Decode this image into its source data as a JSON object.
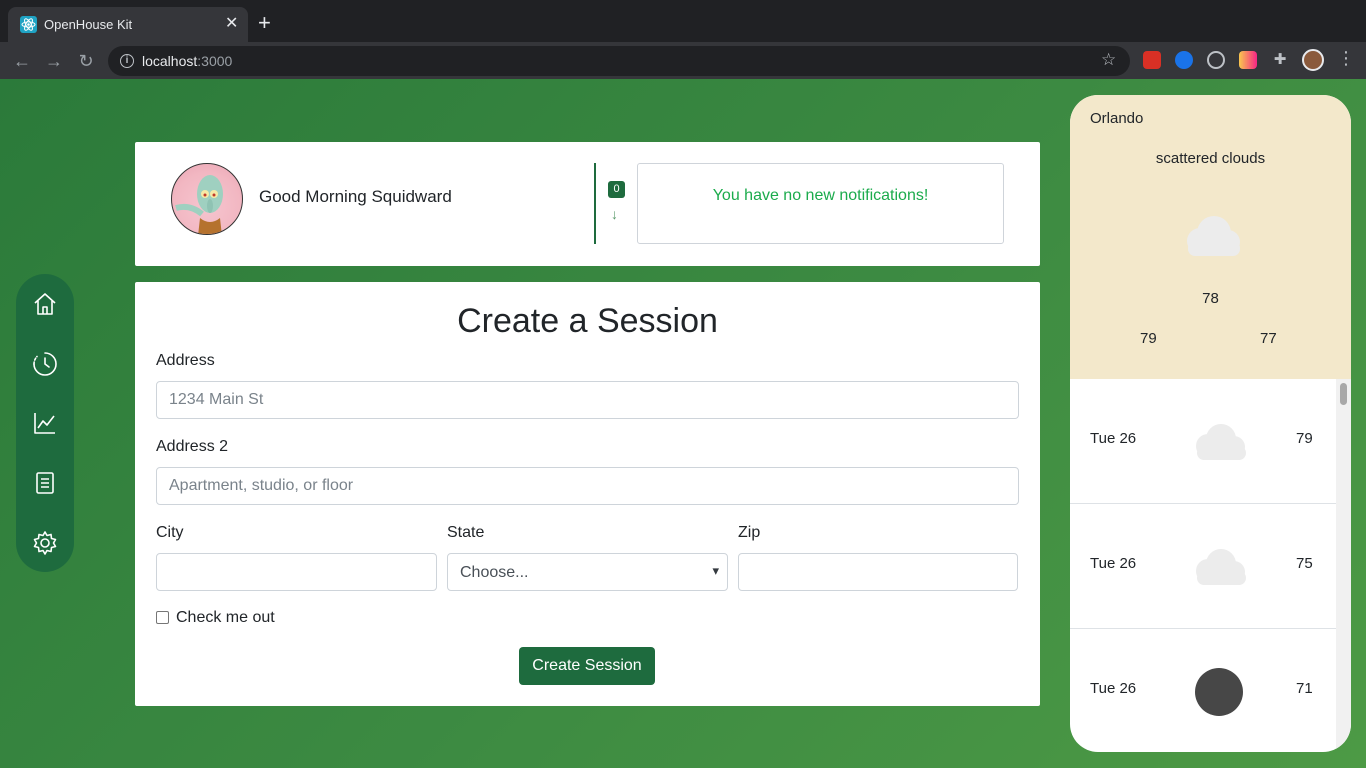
{
  "browser": {
    "tab_title": "OpenHouse Kit",
    "url_host": "localhost",
    "url_port": ":3000"
  },
  "header": {
    "greeting": "Good Morning Squidward",
    "notification_count": "0",
    "notification_message": "You have no new notifications!"
  },
  "sidenav": {
    "items": [
      "home-icon",
      "history-icon",
      "chart-icon",
      "document-icon",
      "settings-icon"
    ]
  },
  "form": {
    "title": "Create a Session",
    "address_label": "Address",
    "address_placeholder": "1234 Main St",
    "address2_label": "Address 2",
    "address2_placeholder": "Apartment, studio, or floor",
    "city_label": "City",
    "state_label": "State",
    "state_value": "Choose...",
    "zip_label": "Zip",
    "checkbox_label": "Check me out",
    "submit_label": "Create Session"
  },
  "weather": {
    "city": "Orlando",
    "description": "scattered clouds",
    "current_temp": "78",
    "high": "79",
    "low": "77",
    "forecast": [
      {
        "day": "Tue 26",
        "icon": "cloud-icon",
        "temp": "79"
      },
      {
        "day": "Tue 26",
        "icon": "cloud-icon",
        "temp": "75"
      },
      {
        "day": "Tue 26",
        "icon": "moon-icon",
        "temp": "71"
      }
    ]
  },
  "colors": {
    "brand": "#1e6b3e",
    "notification_text": "#1bab4c",
    "weather_panel": "#f3e8cb"
  }
}
